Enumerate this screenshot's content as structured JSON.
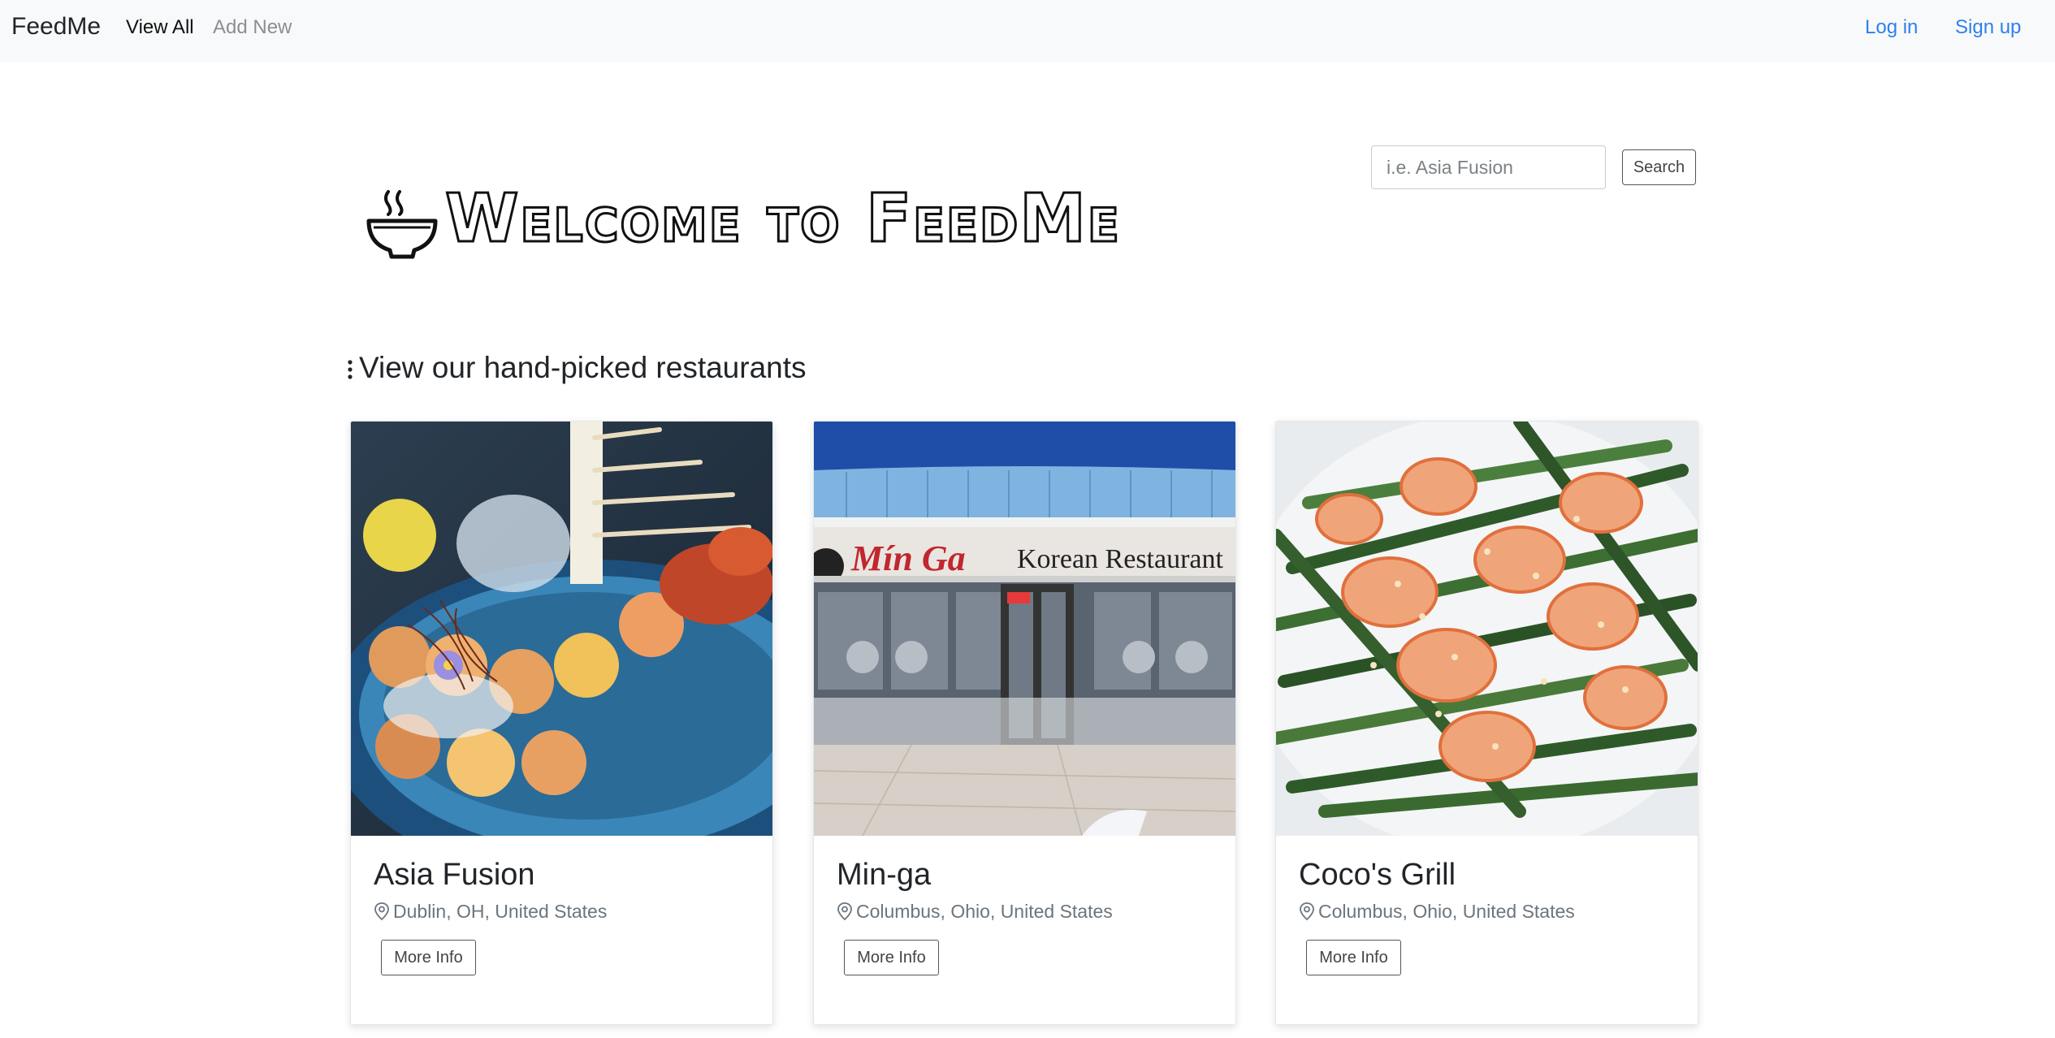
{
  "nav": {
    "brand": "FeedMe",
    "view_all": "View All",
    "add_new": "Add New",
    "login": "Log in",
    "signup": "Sign up"
  },
  "search": {
    "placeholder": "i.e. Asia Fusion",
    "value": "",
    "button_label": "Search"
  },
  "hero": {
    "title": "Welcome to FeedMe",
    "icon": "steaming-bowl-icon"
  },
  "section": {
    "heading": "View our hand-picked restaurants",
    "icon": "vertical-dots-icon"
  },
  "restaurants": [
    {
      "name": "Asia Fusion",
      "location": "Dublin, OH, United States",
      "button": "More Info",
      "image": "sushi-platter-photo"
    },
    {
      "name": "Min-ga",
      "location": "Columbus, Ohio, United States",
      "button": "More Info",
      "image": "restaurant-storefront-photo",
      "sign_text": "Mín Ga",
      "sign_subtext": "Korean Restaurant"
    },
    {
      "name": "Coco's Grill",
      "location": "Columbus, Ohio, United States",
      "button": "More Info",
      "image": "shrimp-green-beans-photo"
    }
  ],
  "colors": {
    "link": "#2f80ed",
    "navbar_bg": "#f8f9fa",
    "muted_text": "#6c757d"
  }
}
